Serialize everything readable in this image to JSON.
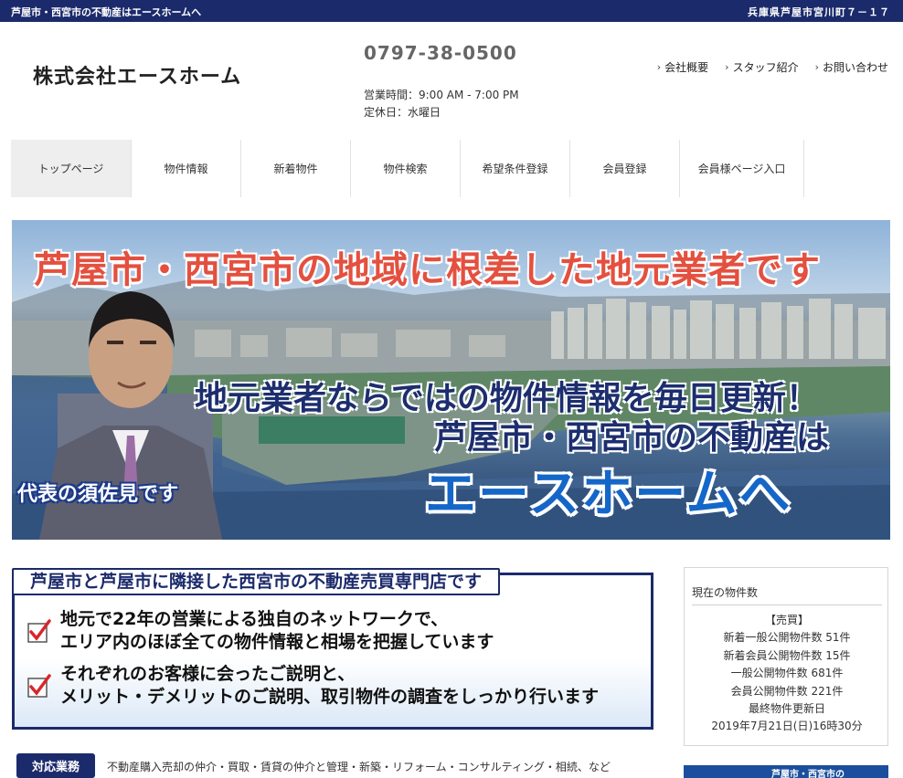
{
  "topbar": {
    "tagline": "芦屋市・西宮市の不動産はエースホームへ",
    "address": "兵庫県芦屋市宮川町７－１７"
  },
  "header": {
    "company_name": "株式会社エースホーム",
    "phone": "0797-38-0500",
    "hours": "営業時間：9:00 AM - 7:00 PM",
    "holiday": "定休日：水曜日",
    "links": [
      {
        "label": "会社概要"
      },
      {
        "label": "スタッフ紹介"
      },
      {
        "label": "お問い合わせ"
      }
    ]
  },
  "nav": {
    "items": [
      {
        "label": "トップページ",
        "active": true
      },
      {
        "label": "物件情報"
      },
      {
        "label": "新着物件"
      },
      {
        "label": "物件検索"
      },
      {
        "label": "希望条件登録"
      },
      {
        "label": "会員登録"
      },
      {
        "label": "会員様ページ入口"
      }
    ]
  },
  "hero": {
    "headline": "芦屋市・西宮市の地域に根差した地元業者です",
    "line2": "地元業者ならではの物件情報を毎日更新！",
    "line3": "芦屋市・西宮市の不動産は",
    "line4": "エースホームへ",
    "caption": "代表の須佐見です"
  },
  "feature": {
    "heading": "芦屋市と芦屋市に隣接した西宮市の不動産売買専門店です",
    "points": [
      {
        "line1": "地元で22年の営業による独自のネットワークで、",
        "line2": "エリア内のほぼ全ての物件情報と相場を把握しています"
      },
      {
        "line1": "それぞれのお客様に会ったご説明と、",
        "line2": "メリット・デメリットのご説明、取引物件の調査をしっかり行います"
      }
    ]
  },
  "sidebar": {
    "title": "現在の物件数",
    "section": "【売買】",
    "stats": [
      "新着一般公開物件数 51件",
      "新着会員公開物件数 15件",
      "一般公開物件数 681件",
      "会員公開物件数 221件",
      "最終物件更新日",
      "2019年7月21日(日)16時30分"
    ],
    "banner_text": "芦屋市・西宮市の"
  },
  "services": {
    "badge": "対応業務",
    "text": "不動産購入売却の仲介・買取・賃貸の仲介と管理・新築・リフォーム・コンサルティング・相続、など"
  },
  "colors": {
    "navy": "#1b2a6b",
    "check_red": "#d9262a",
    "hero_red": "#e4503f",
    "hero_blue": "#1467c9"
  }
}
